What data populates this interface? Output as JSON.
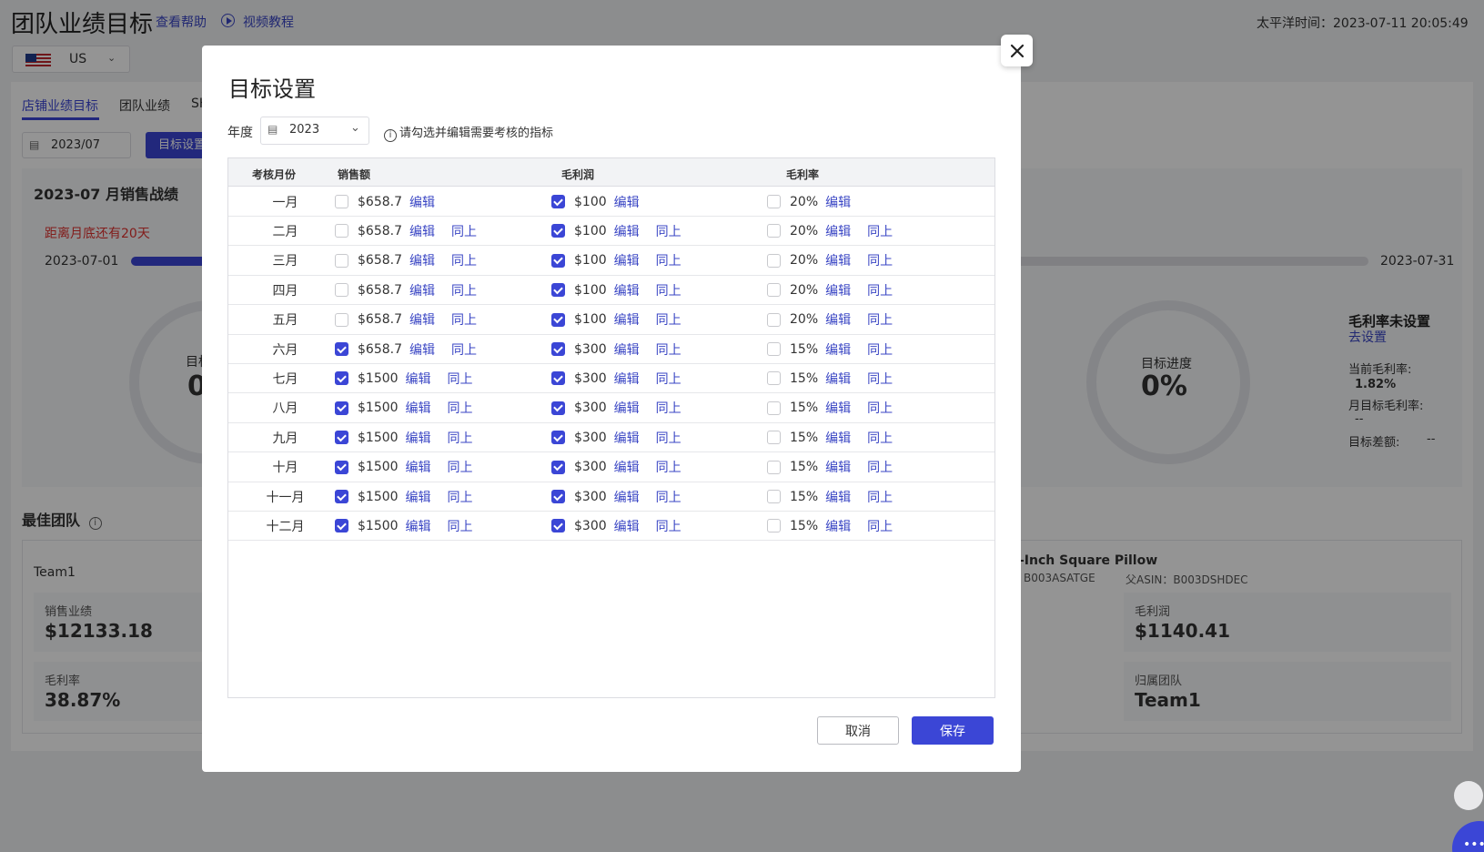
{
  "header": {
    "title": "团队业绩目标",
    "help_link": "查看帮助",
    "video_link": "视频教程",
    "time_label": "太平洋时间：",
    "time_value": "2023-07-11 20:05:49"
  },
  "country_select": {
    "value": "US",
    "flag_icon": "us-flag-icon"
  },
  "page_tabs": [
    {
      "label": "店铺业绩目标",
      "active": true
    },
    {
      "label": "团队业绩",
      "active": false
    },
    {
      "label": "SK",
      "active": false
    }
  ],
  "toolbar": {
    "month_value": "2023/07",
    "target_button": "目标设置"
  },
  "sales_panel": {
    "title": "2023-07 月销售战绩",
    "remaining": "距离月底还有20天",
    "start_date": "2023-07-01",
    "end_date": "2023-07-31",
    "left_gauge_partial_label": "目标",
    "left_gauge_partial_value": "0",
    "gauge_label": "目标进度",
    "gauge_value": "0%",
    "margin_title": "毛利率未设置",
    "margin_link": "去设置",
    "current_margin_label": "当前毛利率:",
    "current_margin_value": "1.82%",
    "monthly_margin_label": "月目标毛利率:",
    "monthly_margin_value": "--",
    "diff_label": "目标差额:",
    "diff_value": "--"
  },
  "best_team": {
    "title": "最佳团队",
    "team_name": "Team1",
    "sales_label": "销售业绩",
    "sales_value": "$12133.18",
    "margin_rate_label": "毛利率",
    "margin_rate_value": "38.87%",
    "product_title": "-Inch Square Pillow",
    "asin_value": "B003ASATGE",
    "parent_asin_label": "父ASIN：",
    "parent_asin_value": "B003DSHDEC",
    "profit_label": "毛利润",
    "profit_value": "$1140.41",
    "team_label": "归属团队",
    "team_value": "Team1"
  },
  "modal": {
    "title": "目标设置",
    "year_label": "年度",
    "year_value": "2023",
    "hint": "请勾选并编辑需要考核的指标",
    "columns": [
      "考核月份",
      "销售额",
      "毛利润",
      "毛利率"
    ],
    "edit_label": "编辑",
    "same_label": "同上",
    "rows": [
      {
        "month": "一月",
        "sales": "$658.7",
        "sales_on": false,
        "profit": "$100",
        "profit_on": true,
        "rate": "20%",
        "rate_on": false,
        "same": false
      },
      {
        "month": "二月",
        "sales": "$658.7",
        "sales_on": false,
        "profit": "$100",
        "profit_on": true,
        "rate": "20%",
        "rate_on": false,
        "same": true
      },
      {
        "month": "三月",
        "sales": "$658.7",
        "sales_on": false,
        "profit": "$100",
        "profit_on": true,
        "rate": "20%",
        "rate_on": false,
        "same": true
      },
      {
        "month": "四月",
        "sales": "$658.7",
        "sales_on": false,
        "profit": "$100",
        "profit_on": true,
        "rate": "20%",
        "rate_on": false,
        "same": true
      },
      {
        "month": "五月",
        "sales": "$658.7",
        "sales_on": false,
        "profit": "$100",
        "profit_on": true,
        "rate": "20%",
        "rate_on": false,
        "same": true
      },
      {
        "month": "六月",
        "sales": "$658.7",
        "sales_on": true,
        "profit": "$300",
        "profit_on": true,
        "rate": "15%",
        "rate_on": false,
        "same": true
      },
      {
        "month": "七月",
        "sales": "$1500",
        "sales_on": true,
        "profit": "$300",
        "profit_on": true,
        "rate": "15%",
        "rate_on": false,
        "same": true
      },
      {
        "month": "八月",
        "sales": "$1500",
        "sales_on": true,
        "profit": "$300",
        "profit_on": true,
        "rate": "15%",
        "rate_on": false,
        "same": true
      },
      {
        "month": "九月",
        "sales": "$1500",
        "sales_on": true,
        "profit": "$300",
        "profit_on": true,
        "rate": "15%",
        "rate_on": false,
        "same": true
      },
      {
        "month": "十月",
        "sales": "$1500",
        "sales_on": true,
        "profit": "$300",
        "profit_on": true,
        "rate": "15%",
        "rate_on": false,
        "same": true
      },
      {
        "month": "十一月",
        "sales": "$1500",
        "sales_on": true,
        "profit": "$300",
        "profit_on": true,
        "rate": "15%",
        "rate_on": false,
        "same": true
      },
      {
        "month": "十二月",
        "sales": "$1500",
        "sales_on": true,
        "profit": "$300",
        "profit_on": true,
        "rate": "15%",
        "rate_on": false,
        "same": true
      }
    ],
    "cancel_button": "取消",
    "save_button": "保存"
  },
  "colors": {
    "accent": "#3b46d6",
    "danger": "#e0322f",
    "overlay": "rgba(0,0,0,0.42)"
  }
}
